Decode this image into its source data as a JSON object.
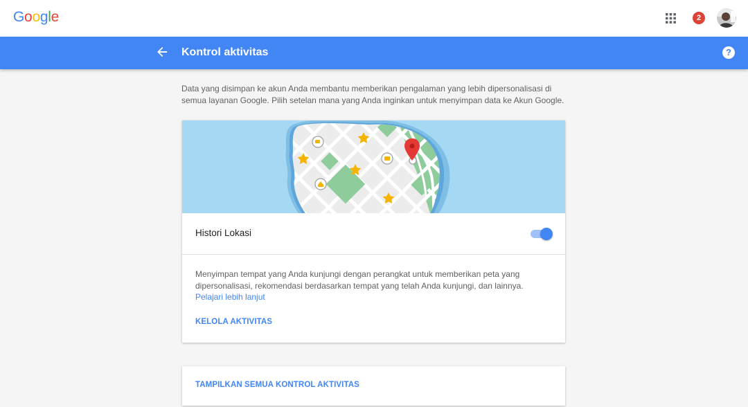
{
  "topbar": {
    "logo_letters": [
      {
        "ch": "G",
        "color": "#4285f4"
      },
      {
        "ch": "o",
        "color": "#ea4335"
      },
      {
        "ch": "o",
        "color": "#fbbc05"
      },
      {
        "ch": "g",
        "color": "#4285f4"
      },
      {
        "ch": "l",
        "color": "#34a853"
      },
      {
        "ch": "e",
        "color": "#ea4335"
      }
    ],
    "notification_count": "2",
    "apps_icon": "apps-grid-icon",
    "avatar_icon": "user-avatar"
  },
  "header": {
    "title": "Kontrol aktivitas",
    "back_icon": "arrow-back-icon",
    "help_icon": "help-icon",
    "help_glyph": "?",
    "background": "#4285f4"
  },
  "intro": {
    "text": "Data yang disimpan ke akun Anda membantu memberikan pengalaman yang lebih dipersonalisasi di semua layanan Google. Pilih setelan mana yang Anda inginkan untuk menyimpan data ke Akun Google."
  },
  "location_card": {
    "title": "Histori Lokasi",
    "toggle_on": true,
    "description": "Menyimpan tempat yang Anda kunjungi dengan perangkat untuk memberikan peta yang dipersonalisasi, rekomendasi berdasarkan tempat yang telah Anda kunjungi, dan lainnya.",
    "learn_more": "Pelajari lebih lanjut",
    "manage_button": "KELOLA AKTIVITAS"
  },
  "footer_card": {
    "button": "TAMPILKAN SEMUA KONTROL AKTIVITAS"
  },
  "colors": {
    "accent": "#4285f4",
    "badge": "#db4437",
    "water": "#a5d8f3",
    "park": "#8fcc9b",
    "star": "#f4b400",
    "pin": "#e53935"
  }
}
